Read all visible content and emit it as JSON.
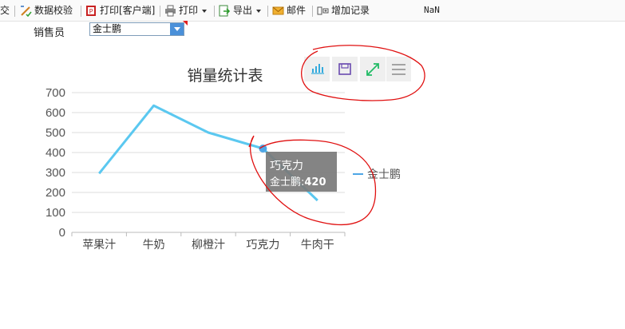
{
  "toolbar": {
    "cut_text": "交",
    "validate_label": "数据校验",
    "print_client_label": "打印[客户端]",
    "print_label": "打印",
    "export_label": "导出",
    "mail_label": "邮件",
    "add_record_label": "增加记录",
    "nan_text": "NaN"
  },
  "params": {
    "salesperson_label": "销售员",
    "salesperson_value": "金士鹏"
  },
  "chart_tools": {
    "icons": [
      "bar-chart-icon",
      "save-icon",
      "fullscreen-icon",
      "menu-icon"
    ]
  },
  "chart_data": {
    "type": "line",
    "title": "销量统计表",
    "categories": [
      "苹果汁",
      "牛奶",
      "柳橙汁",
      "巧克力",
      "牛肉干"
    ],
    "series": [
      {
        "name": "金士鹏",
        "values": [
          295,
          635,
          500,
          420,
          160
        ],
        "color": "#5bc8f0"
      }
    ],
    "ylim": [
      0,
      700
    ],
    "yticks": [
      "0",
      "100",
      "200",
      "300",
      "400",
      "500",
      "600",
      "700"
    ],
    "grid": true,
    "legend": "right",
    "tooltip": {
      "category": "巧克力",
      "series_label": "金士鹏:",
      "value": "420"
    }
  },
  "colors": {
    "line": "#5bc8f0",
    "point": "#4ea6e6",
    "tooltip_bg": "#7a7a7a",
    "annotation": "#e01010",
    "grid": "#dddddd"
  }
}
